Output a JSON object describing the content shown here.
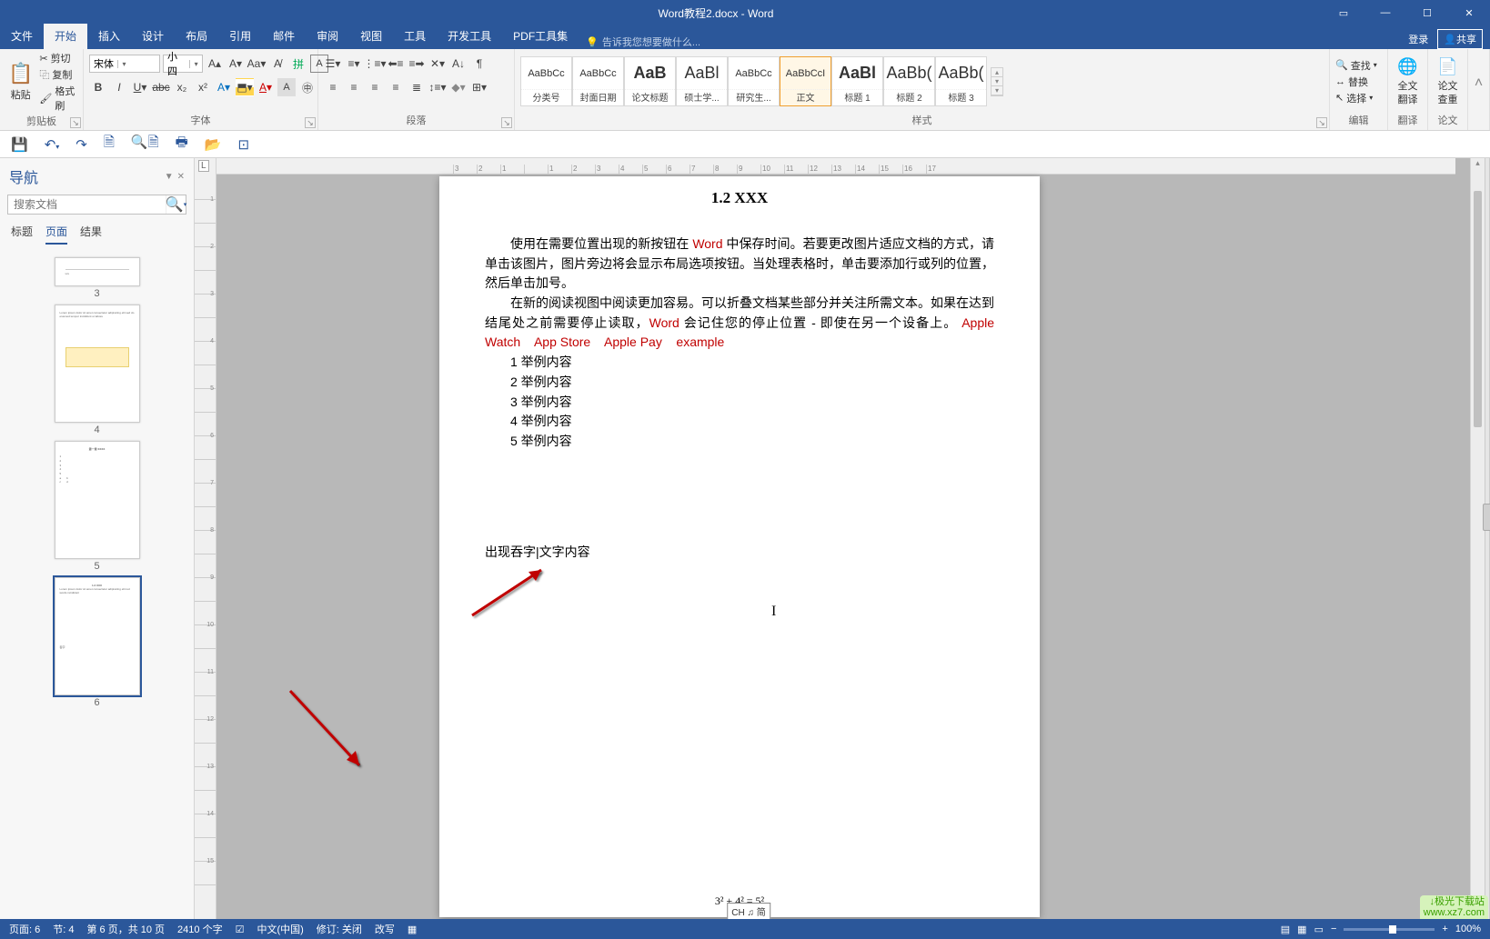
{
  "title": "Word教程2.docx - Word",
  "menubar": {
    "file": "文件",
    "home": "开始",
    "insert": "插入",
    "design": "设计",
    "layout": "布局",
    "references": "引用",
    "mailings": "邮件",
    "review": "审阅",
    "view": "视图",
    "tools": "工具",
    "developer": "开发工具",
    "pdf": "PDF工具集",
    "tellme": "告诉我您想要做什么...",
    "login": "登录",
    "share": "共享"
  },
  "ribbon": {
    "clipboard": {
      "paste": "粘贴",
      "cut": "剪切",
      "copy": "复制",
      "fmt": "格式刷",
      "label": "剪贴板"
    },
    "font": {
      "family": "宋体",
      "size": "小四",
      "label": "字体"
    },
    "para": {
      "label": "段落"
    },
    "styles": {
      "label": "样式",
      "items": [
        {
          "prev": "AaBbCc",
          "name": "分类号",
          "big": false
        },
        {
          "prev": "AaBbCc",
          "name": "封面日期",
          "big": false
        },
        {
          "prev": "AaB",
          "name": "论文标题",
          "big": true,
          "bold": true
        },
        {
          "prev": "AaBl",
          "name": "硕士学...",
          "big": true
        },
        {
          "prev": "AaBbCc",
          "name": "研究生...",
          "big": false
        },
        {
          "prev": "AaBbCcI",
          "name": "正文",
          "big": false,
          "sel": true
        },
        {
          "prev": "AaBl",
          "name": "标题 1",
          "big": true,
          "bold": true,
          "serif": true
        },
        {
          "prev": "AaBb(",
          "name": "标题 2",
          "big": true
        },
        {
          "prev": "AaBb(",
          "name": "标题 3",
          "big": true
        }
      ]
    },
    "edit": {
      "find": "查找",
      "replace": "替换",
      "select": "选择",
      "label": "编辑"
    },
    "trans": {
      "label1": "全文",
      "label2": "翻译",
      "group": "翻译"
    },
    "dup": {
      "label1": "论文",
      "label2": "查重",
      "group": "论文"
    }
  },
  "nav": {
    "title": "导航",
    "search_ph": "搜索文档",
    "tabs": {
      "headings": "标题",
      "pages": "页面",
      "results": "结果"
    },
    "pages": [
      "3",
      "4",
      "5",
      "6"
    ]
  },
  "doc": {
    "heading": "1.2 XXX",
    "p1a": "使用在需要位置出现的新按钮在 ",
    "p1w": "Word",
    "p1b": " 中保存时间。若要更改图片适应文档的方式，请单击该图片，图片旁边将会显示布局选项按钮。当处理表格时，单击要添加行或列的位置，然后单击加号。",
    "p2a": "在新的阅读视图中阅读更加容易。可以折叠文档某些部分并关注所需文本。如果在达到结尾处之前需要停止读取，",
    "p2w": "Word",
    "p2b": " 会记住您的停止位置 - 即使在另一个设备上。",
    "red1": "Apple Watch",
    "red2": "App Store",
    "red3": "Apple Pay",
    "red4": "example",
    "items": [
      "1 举例内容",
      "2 举例内容",
      "3 举例内容",
      "4 举例内容",
      "5 举例内容"
    ],
    "lower": "出现吞字|文字内容",
    "formula": "3² + 4² = 5²",
    "lang": "CH ♫ 简"
  },
  "status": {
    "page": "页面: 6",
    "sec": "节: 4",
    "pageof": "第 6 页，共 10 页",
    "words": "2410 个字",
    "lang": "中文(中国)",
    "track": "修订: 关闭",
    "overtype": "改写",
    "zoom": "100%"
  },
  "watermark": {
    "l1": "↓极光下载站",
    "l2": "www.xz7.com"
  },
  "ruler": [
    "3",
    "2",
    "1",
    "",
    "1",
    "2",
    "3",
    "4",
    "5",
    "6",
    "7",
    "8",
    "9",
    "10",
    "11",
    "12",
    "13",
    "14",
    "15",
    "16",
    "17"
  ]
}
